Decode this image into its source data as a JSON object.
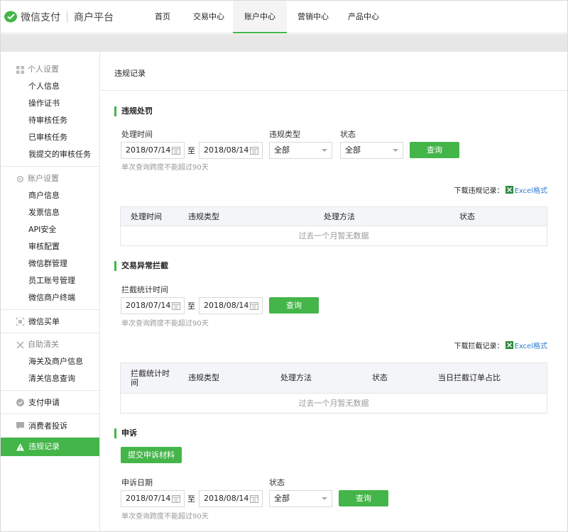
{
  "header": {
    "brand": "微信支付",
    "sub": "商户平台",
    "nav": [
      "首页",
      "交易中心",
      "账户中心",
      "营销中心",
      "产品中心"
    ],
    "active_nav": "账户中心",
    "accent": "#44b549"
  },
  "sidebar": {
    "personal": {
      "title": "个人设置",
      "items": [
        "个人信息",
        "操作证书",
        "待审核任务",
        "已审核任务",
        "我提交的审核任务"
      ]
    },
    "account": {
      "title": "账户设置",
      "items": [
        "商户信息",
        "发票信息",
        "API安全",
        "审核配置",
        "微信群管理",
        "员工账号管理",
        "微信商户终端"
      ]
    },
    "wechat_bill": "微信买单",
    "customs": {
      "title": "自助清关",
      "items": [
        "海关及商户信息",
        "清关信息查询"
      ]
    },
    "pay_apply": "支付申请",
    "complaint": "消费者投诉",
    "violation": "违规记录"
  },
  "content": {
    "title": "违规记录",
    "penalty": {
      "title": "违规处罚",
      "time_label": "处理时间",
      "type_label": "违规类型",
      "status_label": "状态",
      "start": "2018/07/14",
      "to": "至",
      "end": "2018/08/14",
      "type_value": "全部",
      "status_value": "全部",
      "query": "查询",
      "hint": "单次查询跨度不能超过90天",
      "download_label": "下载违规记录：",
      "excel": "Excel格式",
      "columns": [
        "处理时间",
        "违规类型",
        "处理方法",
        "状态"
      ],
      "empty": "过去一个月暂无数据"
    },
    "intercept": {
      "title": "交易异常拦截",
      "time_label": "拦截统计时间",
      "start": "2018/07/14",
      "to": "至",
      "end": "2018/08/14",
      "query": "查询",
      "hint": "单次查询跨度不能超过90天",
      "download_label": "下载拦截记录：",
      "excel": "Excel格式",
      "columns": [
        "拦截统计时间",
        "违规类型",
        "处理方法",
        "状态",
        "当日拦截订单占比"
      ],
      "empty": "过去一个月暂无数据"
    },
    "appeal": {
      "title": "申诉",
      "submit": "提交申诉材料",
      "date_label": "申诉日期",
      "status_label": "状态",
      "start": "2018/07/14",
      "to": "至",
      "end": "2018/08/14",
      "status_value": "全部",
      "query": "查询",
      "hint": "单次查询跨度不能超过90天"
    }
  }
}
